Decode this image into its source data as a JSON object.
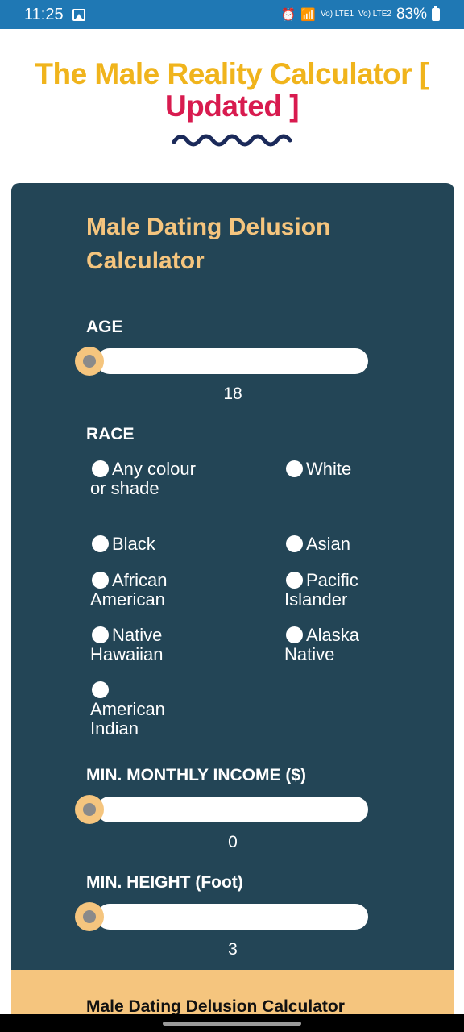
{
  "status": {
    "time": "11:25",
    "battery": "83%",
    "sim1": "Vo) LTE1",
    "sim2": "Vo) LTE2"
  },
  "page": {
    "title_part1": "The Male Reality Calculator [",
    "title_part2": "Updated ]",
    "accent_color": "#f0b41c",
    "accent_color_2": "#d81b4f"
  },
  "card": {
    "title": "Male Dating Delusion Calculator",
    "age": {
      "label": "AGE",
      "value": "18"
    },
    "race": {
      "label": "RACE",
      "options": [
        "Any colour or shade",
        "White",
        "Black",
        "Asian",
        "African American",
        "Pacific Islander",
        "Native Hawaiian",
        "Alaska Native",
        "American Indian"
      ]
    },
    "income": {
      "label": "MIN. MONTHLY INCOME ($)",
      "value": "0"
    },
    "height": {
      "label": "MIN. HEIGHT (Foot)",
      "value": "3"
    },
    "bg_color": "#234556",
    "label_color": "#f5c57e"
  },
  "footer": {
    "text": "Male Dating Delusion Calculator"
  }
}
